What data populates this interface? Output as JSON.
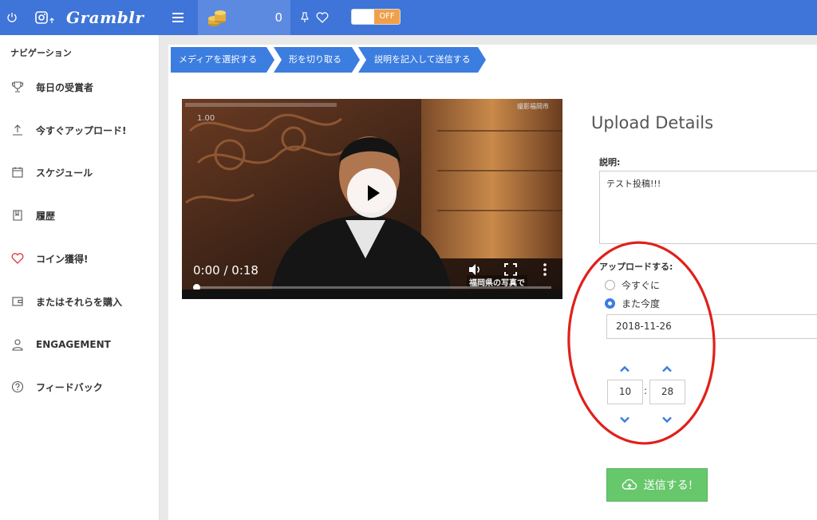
{
  "app": {
    "brand": "Gramblr"
  },
  "topbar": {
    "coins": "0",
    "toggle_state": "OFF"
  },
  "sidebar": {
    "title": "ナビゲーション",
    "items": [
      {
        "label": "毎日の受賞者",
        "icon": "trophy-icon"
      },
      {
        "label": "今すぐアップロード!",
        "icon": "upload-icon"
      },
      {
        "label": "スケジュール",
        "icon": "calendar-icon"
      },
      {
        "label": "履歴",
        "icon": "book-icon"
      },
      {
        "label": "コイン獲得!",
        "icon": "heart-icon"
      },
      {
        "label": "またはそれらを購入",
        "icon": "wallet-icon"
      },
      {
        "label": "ENGAGEMENT",
        "icon": "user-icon"
      },
      {
        "label": "フィードバック",
        "icon": "question-icon"
      }
    ]
  },
  "steps": [
    "メディアを選択する",
    "形を切り取る",
    "説明を記入して送信する"
  ],
  "video": {
    "time": "0:00 / 0:18",
    "caption": "福岡県の写真で",
    "corner_text": "撮影福岡市",
    "speed_label": "1.00",
    "progress": 0
  },
  "details": {
    "title": "Upload Details",
    "description_label": "説明:",
    "description_value": "テスト投稿!!!",
    "upload_label": "アップロードする:",
    "option_now": "今すぐに",
    "option_later": "また今度",
    "selected_option": "later",
    "date": "2018-11-26",
    "hour": "10",
    "minute": "28",
    "time_separator": ":",
    "send_label": "送信する!"
  },
  "colors": {
    "topbar": "#3f74d8",
    "step_arrow": "#3c7de0",
    "send_button": "#67c76b",
    "annotation": "#e0201b"
  }
}
